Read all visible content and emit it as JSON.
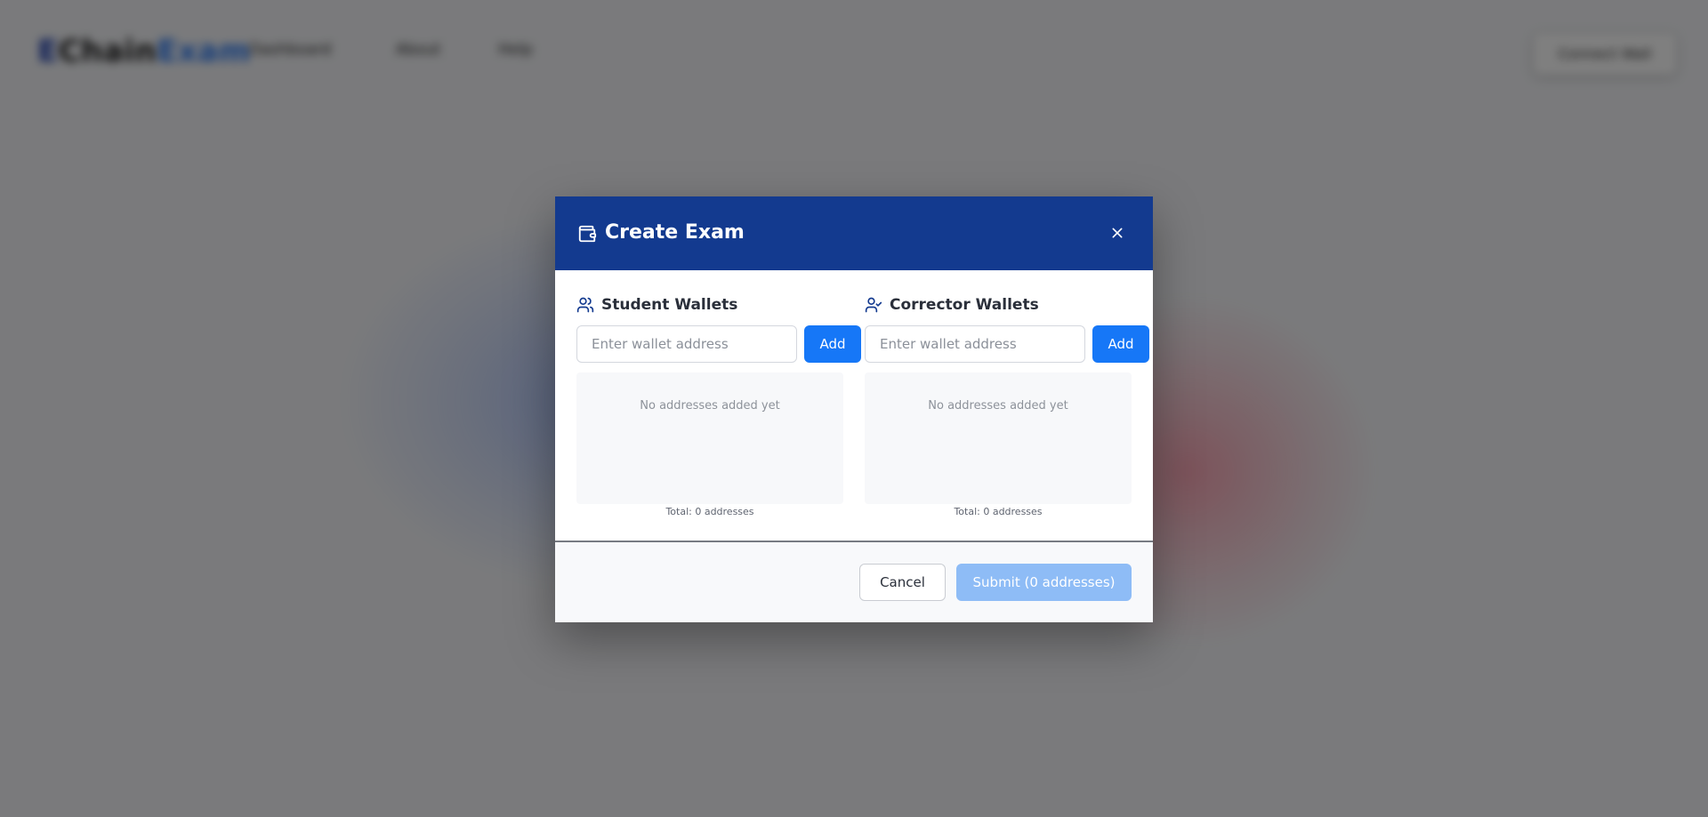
{
  "background": {
    "logo": {
      "part1": "E",
      "part2": "Chain",
      "part3": "Exam"
    },
    "nav": [
      "Dashboard",
      "About",
      "Help"
    ],
    "connect_label": "Connect Wall"
  },
  "modal": {
    "title": "Create Exam",
    "close_icon": "close-icon",
    "student": {
      "title": "Student Wallets",
      "icon": "users-icon",
      "placeholder": "Enter wallet address",
      "add_label": "Add",
      "empty_text": "No addresses added yet",
      "total_text": "Total: 0 addresses"
    },
    "corrector": {
      "title": "Corrector Wallets",
      "icon": "user-check-icon",
      "placeholder": "Enter wallet address",
      "add_label": "Add",
      "empty_text": "No addresses added yet",
      "total_text": "Total: 0 addresses"
    },
    "footer": {
      "cancel_label": "Cancel",
      "submit_label": "Submit (0 addresses)"
    }
  },
  "colors": {
    "header": "#133a8f",
    "primary": "#1677f7",
    "submit_disabled": "#8ebcf6"
  }
}
